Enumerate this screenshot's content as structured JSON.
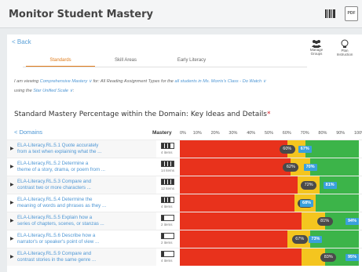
{
  "header": {
    "title": "Monitor Student Mastery",
    "pdf_label": "PDF"
  },
  "toolbar": {
    "back_label": "< Back",
    "manage_groups_label": "Manage Groups",
    "plan_instruction_label": "Plan Instruction"
  },
  "tabs": [
    {
      "label": "Standards",
      "active": true
    },
    {
      "label": "Skill Areas",
      "active": false
    },
    {
      "label": "Early Literacy",
      "active": false
    }
  ],
  "filter": {
    "prefix": "I am viewing",
    "mastery_type": "Comprehensive Mastery",
    "for_text": "for: All Reading Assignment Types for the",
    "class_link": "all students in Ms. Morris's Class - Do Watch",
    "using_text": "using the",
    "scale_link": "Star Unified Scale"
  },
  "section": {
    "title": "Standard Mastery Percentage within the Domain: Key Ideas and Details",
    "required_mark": "*"
  },
  "table": {
    "domains_label": "< Domains",
    "mastery_label": "Mastery",
    "percent_ticks": [
      "0%",
      "10%",
      "20%",
      "30%",
      "40%",
      "50%",
      "60%",
      "70%",
      "80%",
      "90%",
      "100%"
    ]
  },
  "colors": {
    "red": "#e8321c",
    "yellow": "#f4c51f",
    "green": "#3cb449",
    "blue": "#3aa0dc"
  },
  "rows": [
    {
      "line1": "ELA-Literacy.RL.5.1 Quote accurately",
      "line2": "from a text when explaining what the ...",
      "items": "4 items",
      "bars": 3,
      "yellow_start": 60,
      "green_start": 70,
      "dark_label": "60%",
      "dark_value": 60,
      "blue_label": "67%",
      "blue_value": 67
    },
    {
      "line1": "ELA-Literacy.RL.5.2 Determine a",
      "line2": "theme of a story, drama, or poem from ...",
      "items": "14 items",
      "bars": 4,
      "yellow_start": 62,
      "green_start": 73,
      "dark_label": "62%",
      "dark_value": 62,
      "blue_label": "70%",
      "blue_value": 70
    },
    {
      "line1": "ELA-Literacy.RL.5.3 Compare and",
      "line2": "contrast two or more characters ...",
      "items": "12 items",
      "bars": 4,
      "yellow_start": 66,
      "green_start": 78,
      "dark_label": "72%",
      "dark_value": 72,
      "blue_label": "81%",
      "blue_value": 81
    },
    {
      "line1": "ELA-Literacy.RL.5.4 Determine the",
      "line2": "meaning of words and phrases as they ...",
      "items": "4 items",
      "bars": 3,
      "yellow_start": 64,
      "green_start": 76,
      "dark_label": "70%",
      "dark_value": 70,
      "blue_label": "68%",
      "blue_value": 68
    },
    {
      "line1": "ELA-Literacy.RL.5.5 Explain how a",
      "line2": "series of chapters, scenes, or stanzas ...",
      "items": "2 items",
      "bars": 1,
      "yellow_start": 68,
      "green_start": 81,
      "dark_label": "81%",
      "dark_value": 81,
      "blue_label": "94%",
      "blue_value": 94
    },
    {
      "line1": "ELA-Literacy.RL.5.6 Describe how a",
      "line2": "narrator's or speaker's point of view ...",
      "items": "2 items",
      "bars": 1,
      "yellow_start": 60,
      "green_start": 73,
      "dark_label": "67%",
      "dark_value": 67,
      "blue_label": "73%",
      "blue_value": 73
    },
    {
      "line1": "ELA-Literacy.RL.5.9 Compare and",
      "line2": "contrast stories in the same genre ...",
      "items": "4 items",
      "bars": 1,
      "yellow_start": 68,
      "green_start": 81,
      "dark_label": "83%",
      "dark_value": 83,
      "blue_label": "95%",
      "blue_value": 95
    }
  ]
}
